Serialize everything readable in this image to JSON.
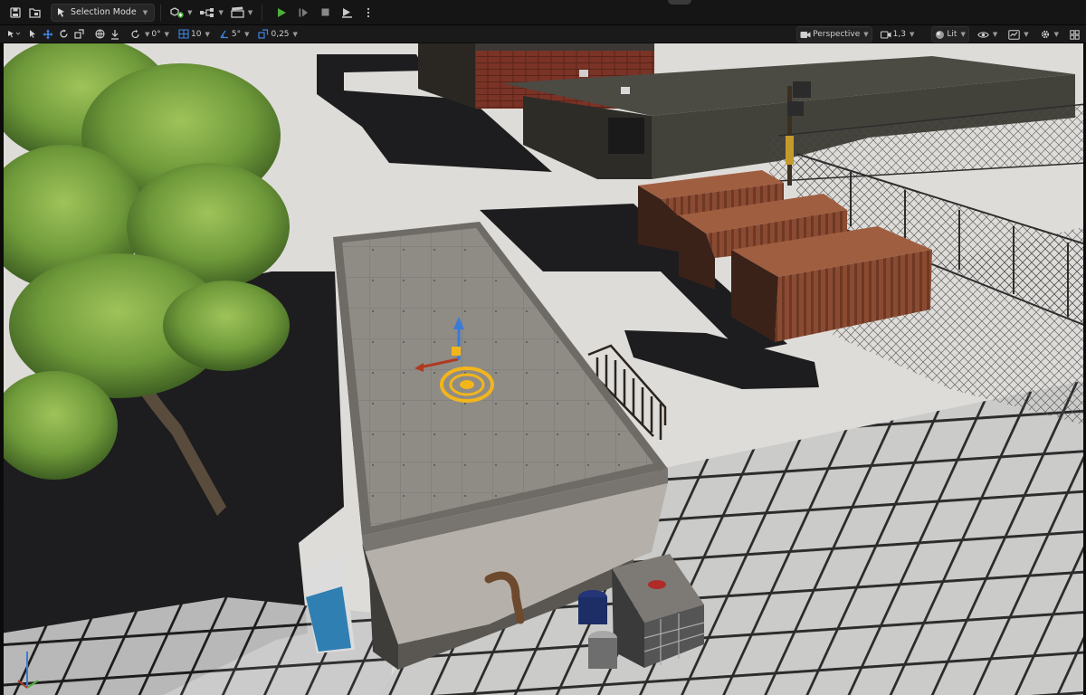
{
  "toolbar": {
    "mode_label": "Selection Mode",
    "icons": [
      "save-icon",
      "content-browser-icon",
      "add-actor-icon",
      "blueprint-icon",
      "cinematics-icon",
      "play-icon",
      "step-icon",
      "stop-icon",
      "eject-icon",
      "more-options-icon"
    ]
  },
  "viewport_toolbar": {
    "rotation_snap": "0°",
    "grid_snap": "10",
    "angle_snap": "5°",
    "scale_snap": "0,25",
    "view_mode": "Perspective",
    "camera_speed": "1,3",
    "lighting": "Lit"
  },
  "colors": {
    "accent_blue": "#3f86e6",
    "play_green": "#4caf3b",
    "gizmo_yellow": "#f2b51c",
    "gizmo_z_blue": "#3a7bd8",
    "gizmo_x_red": "#b03a20"
  }
}
